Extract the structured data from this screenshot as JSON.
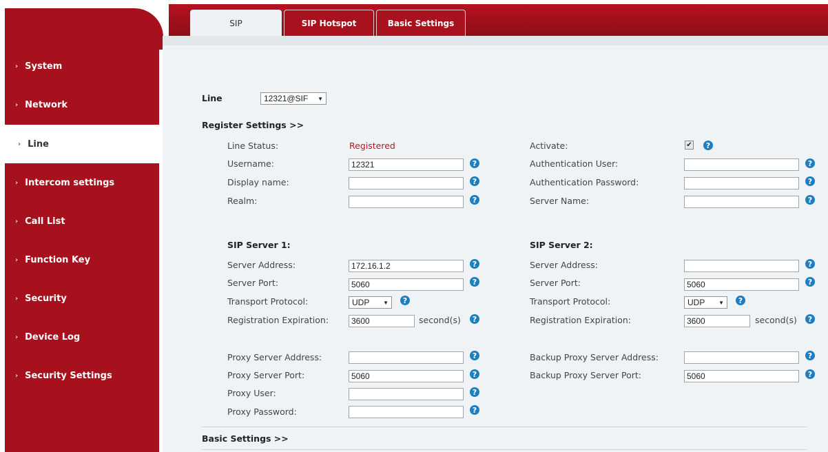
{
  "tabs": [
    {
      "label": "SIP",
      "active": true
    },
    {
      "label": "SIP Hotspot",
      "active": false
    },
    {
      "label": "Basic Settings",
      "active": false
    }
  ],
  "sidebar": {
    "items": [
      {
        "label": "System",
        "active": false
      },
      {
        "label": "Network",
        "active": false
      },
      {
        "label": "Line",
        "active": true
      },
      {
        "label": "Intercom settings",
        "active": false
      },
      {
        "label": "Call List",
        "active": false
      },
      {
        "label": "Function Key",
        "active": false
      },
      {
        "label": "Security",
        "active": false
      },
      {
        "label": "Device Log",
        "active": false
      },
      {
        "label": "Security Settings",
        "active": false
      }
    ]
  },
  "line": {
    "label": "Line",
    "value": "12321@SIF"
  },
  "register": {
    "heading": "Register Settings >>",
    "line_status_label": "Line Status:",
    "line_status_value": "Registered",
    "username_label": "Username:",
    "username_value": "12321",
    "display_name_label": "Display name:",
    "display_name_value": "",
    "realm_label": "Realm:",
    "realm_value": "",
    "activate_label": "Activate:",
    "activate_checked": true,
    "auth_user_label": "Authentication User:",
    "auth_user_value": "",
    "auth_password_label": "Authentication Password:",
    "auth_password_value": "",
    "server_name_label": "Server Name:",
    "server_name_value": ""
  },
  "sip1": {
    "heading": "SIP Server 1:",
    "address_label": "Server Address:",
    "address_value": "172.16.1.2",
    "port_label": "Server Port:",
    "port_value": "5060",
    "transport_label": "Transport Protocol:",
    "transport_value": "UDP",
    "expiration_label": "Registration Expiration:",
    "expiration_value": "3600",
    "expiration_unit": "second(s)"
  },
  "sip2": {
    "heading": "SIP Server 2:",
    "address_label": "Server Address:",
    "address_value": "",
    "port_label": "Server Port:",
    "port_value": "5060",
    "transport_label": "Transport Protocol:",
    "transport_value": "UDP",
    "expiration_label": "Registration Expiration:",
    "expiration_value": "3600",
    "expiration_unit": "second(s)"
  },
  "proxy": {
    "address_label": "Proxy Server Address:",
    "address_value": "",
    "port_label": "Proxy Server Port:",
    "port_value": "5060",
    "user_label": "Proxy User:",
    "user_value": "",
    "password_label": "Proxy Password:",
    "password_value": "",
    "backup_address_label": "Backup Proxy Server Address:",
    "backup_address_value": "",
    "backup_port_label": "Backup Proxy Server Port:",
    "backup_port_value": "5060"
  },
  "basic_settings_heading": "Basic Settings >>",
  "help_glyph": "?",
  "chevron_glyph": "›",
  "colors": {
    "brand_red": "#a6111d",
    "status_red": "#c0141f",
    "help_blue": "#1d7fbf",
    "panel_bg": "#eff3f5"
  }
}
